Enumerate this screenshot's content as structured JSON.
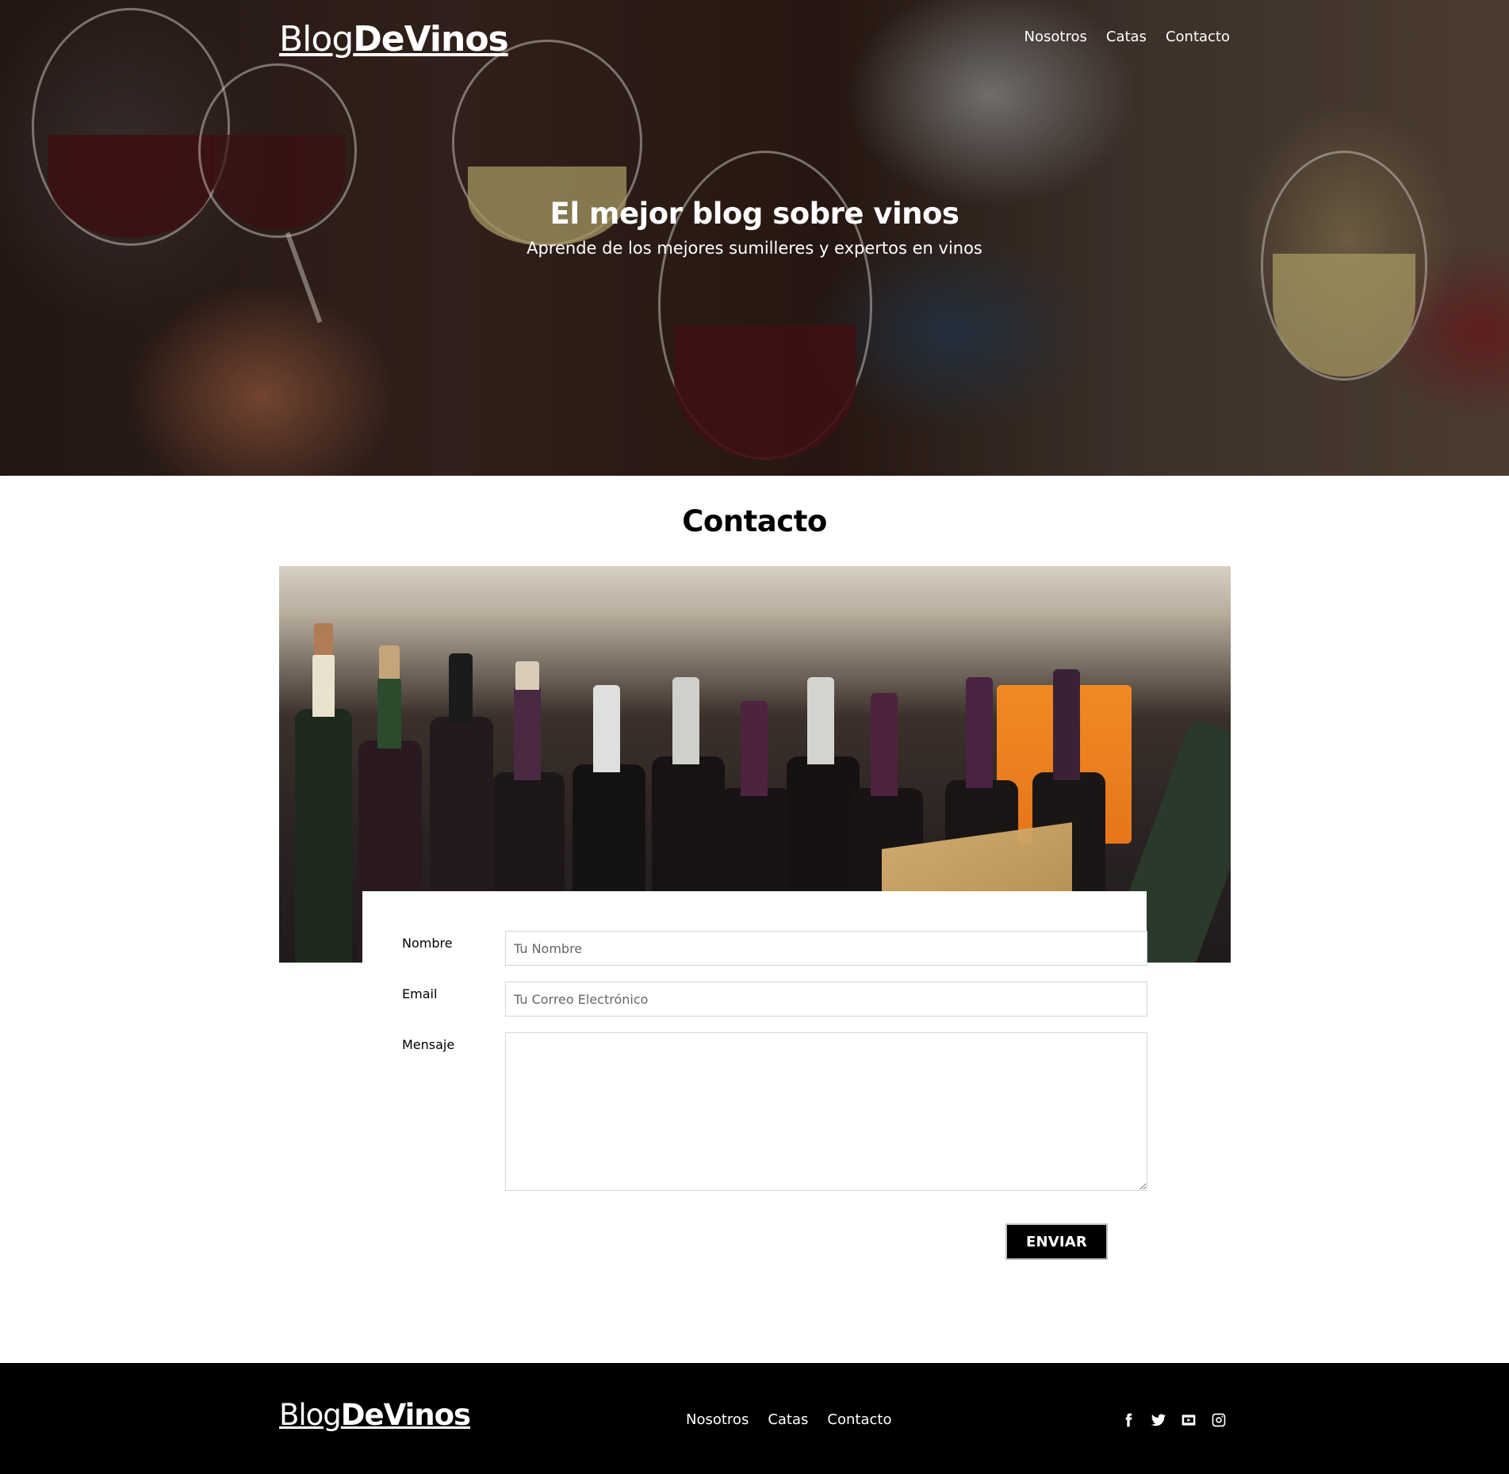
{
  "header": {
    "brand_light": "Blog",
    "brand_bold": "DeVinos",
    "nav": [
      {
        "label": "Nosotros"
      },
      {
        "label": "Catas"
      },
      {
        "label": "Contacto"
      }
    ]
  },
  "hero": {
    "title": "El mejor blog sobre vinos",
    "subtitle": "Aprende de los mejores sumilleres y expertos en vinos"
  },
  "contact": {
    "title": "Contacto",
    "form": {
      "name_label": "Nombre",
      "name_placeholder": "Tu Nombre",
      "email_label": "Email",
      "email_placeholder": "Tu Correo Electrónico",
      "message_label": "Mensaje",
      "submit_label": "ENVIAR"
    }
  },
  "footer": {
    "brand_light": "Blog",
    "brand_bold": "DeVinos",
    "nav": [
      {
        "label": "Nosotros"
      },
      {
        "label": "Catas"
      },
      {
        "label": "Contacto"
      }
    ],
    "social": [
      "facebook-icon",
      "twitter-icon",
      "youtube-icon",
      "instagram-icon"
    ]
  },
  "colors": {
    "footer_bg": "#000000",
    "button_bg": "#000000",
    "text_light": "#ffffff"
  }
}
